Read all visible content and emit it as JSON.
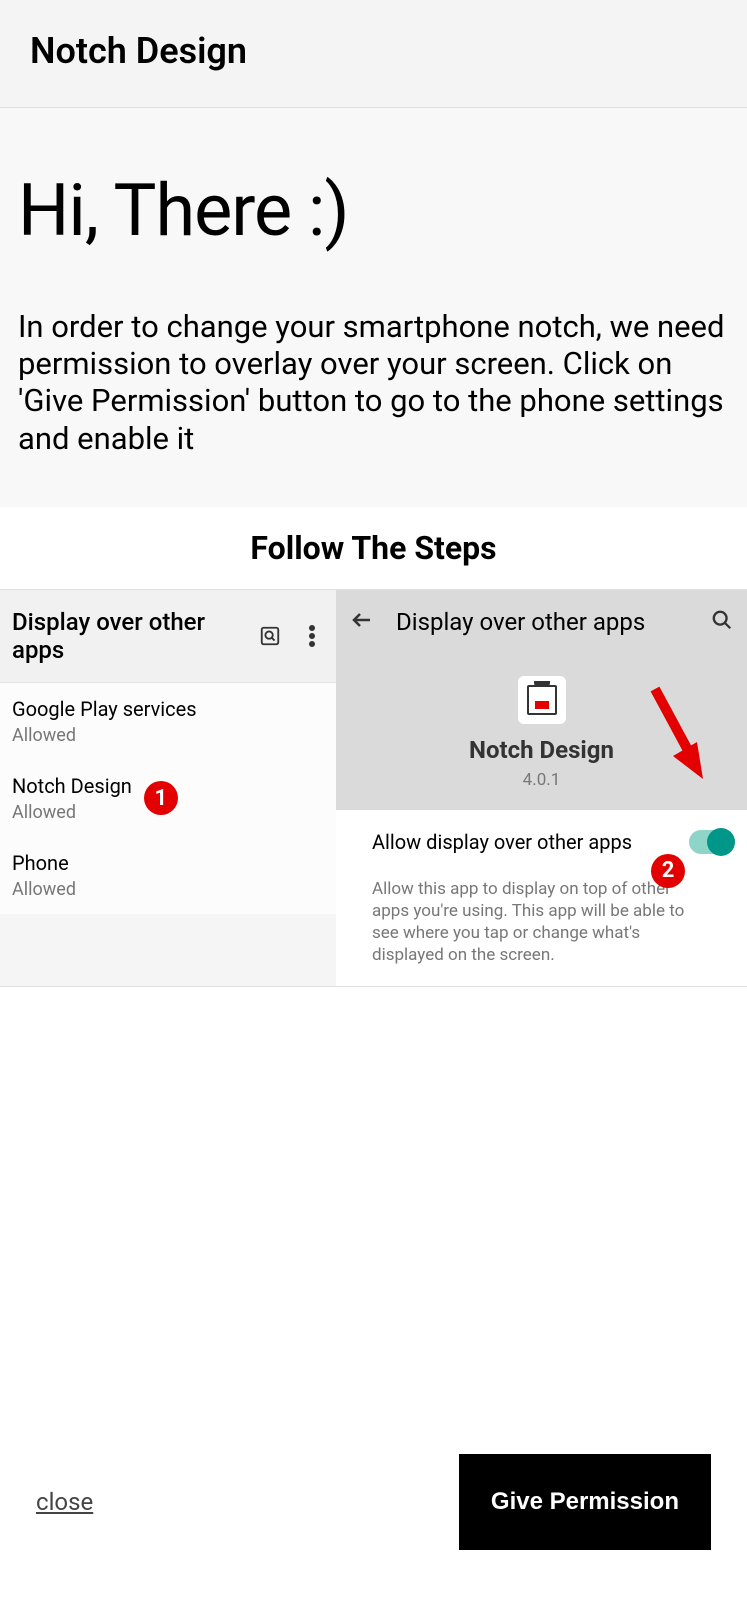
{
  "header": {
    "title": "Notch Design"
  },
  "intro": {
    "greeting": "Hi, There :)",
    "instruction": "In order to change your smartphone notch, we need permission to overlay over your screen. Click on 'Give Permission' button to go to the phone settings and enable it"
  },
  "steps": {
    "title": "Follow The Steps",
    "left": {
      "topbar_title": "Display over other apps",
      "apps": [
        {
          "name": "Google Play services",
          "status": "Allowed"
        },
        {
          "name": "Notch Design",
          "status": "Allowed"
        },
        {
          "name": "Phone",
          "status": "Allowed"
        }
      ],
      "badge1": "1"
    },
    "right": {
      "header_title": "Display over other apps",
      "app_name": "Notch Design",
      "app_version": "4.0.1",
      "switch_label": "Allow display over other apps",
      "switch_desc": "Allow this app to display on top of other apps you're using. This app will be able to see where you tap or change what's displayed on the screen.",
      "badge2": "2"
    }
  },
  "footer": {
    "close": "close",
    "button": "Give Permission"
  }
}
